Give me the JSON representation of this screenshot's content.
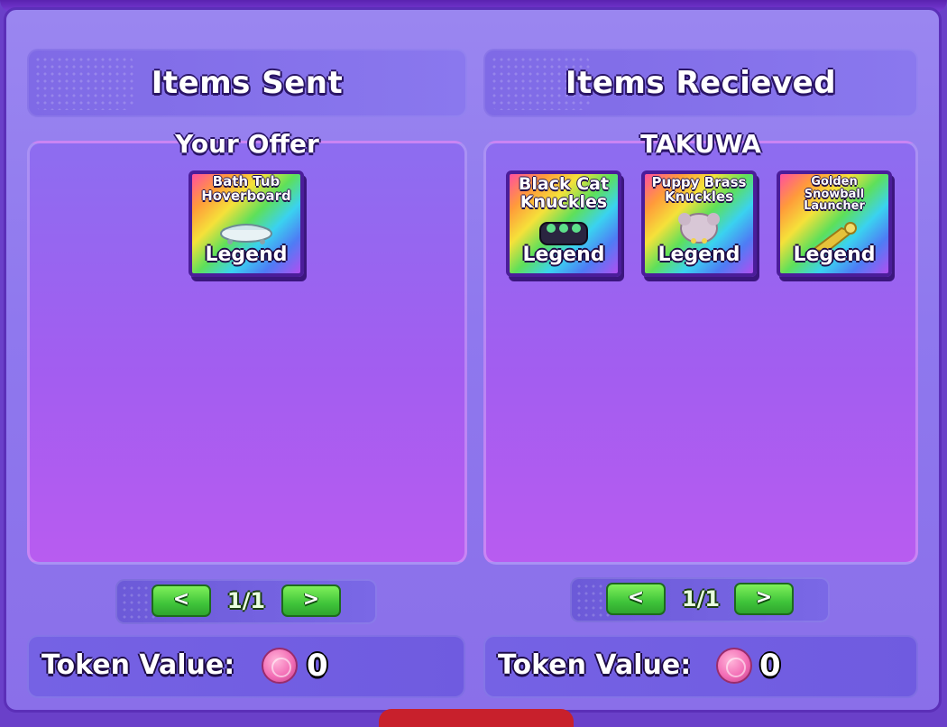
{
  "left": {
    "header_title": "Items Sent",
    "panel_title": "Your Offer",
    "items": [
      {
        "name": "Bath Tub Hoverboard",
        "rarity": "Legend",
        "icon": "bathtub-hoverboard-icon"
      }
    ],
    "pager": {
      "prev_label": "<",
      "page": "1/1",
      "next_label": ">"
    },
    "token": {
      "label": "Token Value:",
      "value": "0",
      "icon": "token-coin-icon"
    }
  },
  "right": {
    "header_title": "Items Recieved",
    "panel_title": "TAKUWA",
    "items": [
      {
        "name": "Black Cat Knuckles",
        "rarity": "Legend",
        "icon": "black-cat-knuckles-icon"
      },
      {
        "name": "Puppy Brass Knuckles",
        "rarity": "Legend",
        "icon": "puppy-brass-knuckles-icon"
      },
      {
        "name": "Golden Snowball Launcher",
        "rarity": "Legend",
        "icon": "golden-snowball-launcher-icon"
      }
    ],
    "pager": {
      "prev_label": "<",
      "page": "1/1",
      "next_label": ">"
    },
    "token": {
      "label": "Token Value:",
      "value": "0",
      "icon": "token-coin-icon"
    }
  },
  "colors": {
    "frame": "#9a86f0",
    "panel_top": "#8d6df0",
    "panel_bottom": "#b85cf0",
    "button_green": "#3fc43a",
    "coin_pink": "#f36eb6"
  }
}
